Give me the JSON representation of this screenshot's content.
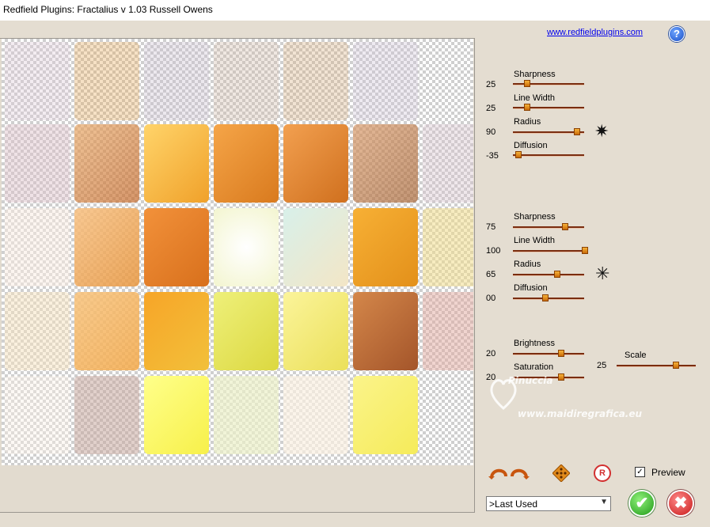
{
  "window": {
    "title": "Redfield Plugins: Fractalius v 1.03   Russell Owens"
  },
  "header": {
    "link_text": "www.redfieldplugins.com",
    "help_glyph": "?"
  },
  "colors": {
    "accent": "#d86d0a",
    "track": "#7a2d10",
    "background": "#e4ddd1"
  },
  "group1": {
    "sliders": [
      {
        "label": "Sharpness",
        "value": "25"
      },
      {
        "label": "Line Width",
        "value": "25"
      },
      {
        "label": "Radius",
        "value": "90"
      },
      {
        "label": "Diffusion",
        "value": "-35"
      }
    ]
  },
  "group2": {
    "sliders": [
      {
        "label": "Sharpness",
        "value": "75"
      },
      {
        "label": "Line Width",
        "value": "100"
      },
      {
        "label": "Radius",
        "value": "65"
      },
      {
        "label": "Diffusion",
        "value": "00"
      }
    ]
  },
  "group3": {
    "sliders": [
      {
        "label": "Brightness",
        "value": "20"
      },
      {
        "label": "Saturation",
        "value": "20"
      },
      {
        "label": "Scale",
        "value": "25"
      }
    ]
  },
  "watermark": {
    "name": "Pinuccia",
    "site": "www.maidiregrafica.eu"
  },
  "controls": {
    "preview_label": "Preview",
    "preview_checked": true,
    "check_glyph": "✓",
    "reset_glyph": "R",
    "preset_selected": ">Last Used",
    "ok_glyph": "✔",
    "cancel_glyph": "✖"
  },
  "icons": {
    "undo_redo": "curved-arrows-icon",
    "randomize": "diamond-dice-icon",
    "reset": "r-circle-icon",
    "variation": "asterisk-star-icon",
    "ok": "check-icon",
    "cancel": "close-icon"
  }
}
